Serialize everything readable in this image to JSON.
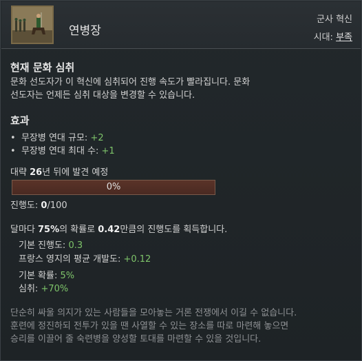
{
  "header": {
    "title": "연병장",
    "type_label": "군사 혁신",
    "era_prefix": "시대: ",
    "era_value": "부족"
  },
  "section_culture": {
    "heading": "현재 문화 심취",
    "line1": "문화 선도자가 이 혁신에 심취되어 진행 속도가 빨라집니다. 문화",
    "line2": "선도자는 언제든 심취 대상을 변경할 수 있습니다."
  },
  "section_effects": {
    "heading": "효과",
    "items": [
      {
        "bullet": "•",
        "label": "무장병 연대 규모: ",
        "value": "+2"
      },
      {
        "bullet": "•",
        "label": "무장병 연대 최대 수: ",
        "value": "+1"
      }
    ]
  },
  "discovery": {
    "prefix": "대략 ",
    "number": "26",
    "suffix": "년 뒤에 발견 예정",
    "progress_text": "0%",
    "progress_fraction": 0
  },
  "progress_line": {
    "label": "진행도: ",
    "current": "0",
    "max": "/100"
  },
  "monthly": {
    "p1": "달마다 ",
    "percent": "75%",
    "p2": "의 확률로 ",
    "amount": "0.42",
    "p3": "만큼의 진행도를 획득합니다."
  },
  "breakdown": {
    "base_progress_label": "기본 진행도: ",
    "base_progress_value": "0.3",
    "dev_label": "프랑스 영지의 평균 개발도: ",
    "dev_value": "+0.12",
    "base_chance_label": "기본 확률: ",
    "base_chance_value": "5%",
    "fascination_label": "심취: ",
    "fascination_value": "+70%"
  },
  "lore": {
    "line1": "단순히 싸울 의지가 있는 사람들을 모아놓는 거론 전쟁에서 이길 수 없습니다.",
    "line2": "훈련에 정진하되 전투가 있을 땐 사열할 수 있는 장소를 따로 마련해 놓으면",
    "line3": "승리를 이끌어 줄 숙련병을 양성할 토대를 마련할 수 있을 것입니다."
  },
  "colors": {
    "positive": "#7ec46a",
    "background": "#1f2427",
    "progress_bar": "#4a2a22"
  }
}
